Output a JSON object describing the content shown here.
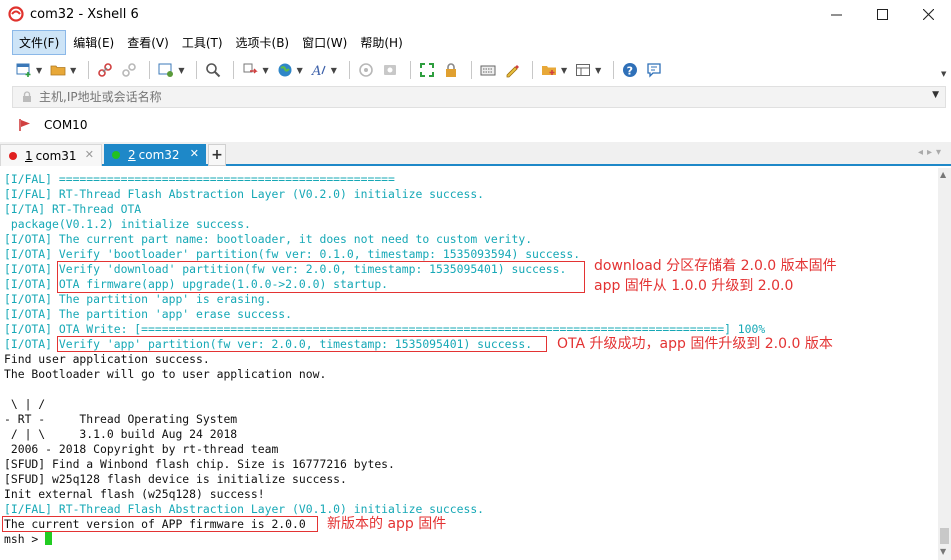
{
  "window": {
    "title": "com32 - Xshell 6"
  },
  "menu": [
    "文件(F)",
    "编辑(E)",
    "查看(V)",
    "工具(T)",
    "选项卡(B)",
    "窗口(W)",
    "帮助(H)"
  ],
  "address": {
    "placeholder": "主机,IP地址或会话名称"
  },
  "session": {
    "label": "COM10"
  },
  "tabs": [
    {
      "num": "1",
      "label": "com31",
      "dot": "#e02020"
    },
    {
      "num": "2",
      "label": "com32",
      "dot": "#22c022"
    }
  ],
  "terminal": {
    "lines": [
      {
        "t": "[I/FAL] =================================================",
        "c": "cyan"
      },
      {
        "t": "[I/FAL] RT-Thread Flash Abstraction Layer (V0.2.0) initialize success.",
        "c": "cyan"
      },
      {
        "t": "[I/TA] RT-Thread OTA",
        "c": "cyan"
      },
      {
        "t": " package(V0.1.2) initialize success.",
        "c": "cyan"
      },
      {
        "t": "[I/OTA] The current part name: bootloader, it does not need to custom verity.",
        "c": "cyan"
      },
      {
        "t": "[I/OTA] Verify 'bootloader' partition(fw ver: 0.1.0, timestamp: 1535093594) success.",
        "c": "cyan"
      },
      {
        "t": "[I/OTA] Verify 'download' partition(fw ver: 2.0.0, timestamp: 1535095401) success.",
        "c": "cyan"
      },
      {
        "t": "[I/OTA] OTA firmware(app) upgrade(1.0.0->2.0.0) startup.",
        "c": "cyan"
      },
      {
        "t": "[I/OTA] The partition 'app' is erasing.",
        "c": "cyan"
      },
      {
        "t": "[I/OTA] The partition 'app' erase success.",
        "c": "cyan"
      },
      {
        "t": "[I/OTA] OTA Write: [=====================================================================================] 100%",
        "c": "cyan"
      },
      {
        "t": "[I/OTA] Verify 'app' partition(fw ver: 2.0.0, timestamp: 1535095401) success.",
        "c": "cyan"
      },
      {
        "t": "Find user application success.",
        "c": "black"
      },
      {
        "t": "The Bootloader will go to user application now.",
        "c": "black"
      },
      {
        "t": "",
        "c": "black"
      },
      {
        "t": " \\ | /",
        "c": "black"
      },
      {
        "t": "- RT -     Thread Operating System",
        "c": "black"
      },
      {
        "t": " / | \\     3.1.0 build Aug 24 2018",
        "c": "black"
      },
      {
        "t": " 2006 - 2018 Copyright by rt-thread team",
        "c": "black"
      },
      {
        "t": "[SFUD] Find a Winbond flash chip. Size is 16777216 bytes.",
        "c": "black"
      },
      {
        "t": "[SFUD] w25q128 flash device is initialize success.",
        "c": "black"
      },
      {
        "t": "Init external flash (w25q128) success!",
        "c": "black"
      },
      {
        "t": "[I/FAL] RT-Thread Flash Abstraction Layer (V0.1.0) initialize success.",
        "c": "cyan"
      },
      {
        "t": "The current version of APP firmware is 2.0.0",
        "c": "black"
      },
      {
        "t": "msh >",
        "c": "black"
      }
    ]
  },
  "annotations": {
    "download_note": "download 分区存储着 2.0.0 版本固件",
    "upgrade_note": "app 固件从 1.0.0 升级到 2.0.0",
    "ota_note": "OTA 升级成功，app 固件升级到 2.0.0 版本",
    "version_note": "新版本的 app 固件"
  },
  "colors": {
    "accent": "#1e88c8",
    "terminal_text": "#16a8b6",
    "annotation": "#e33333",
    "cursor": "#22cc22"
  }
}
